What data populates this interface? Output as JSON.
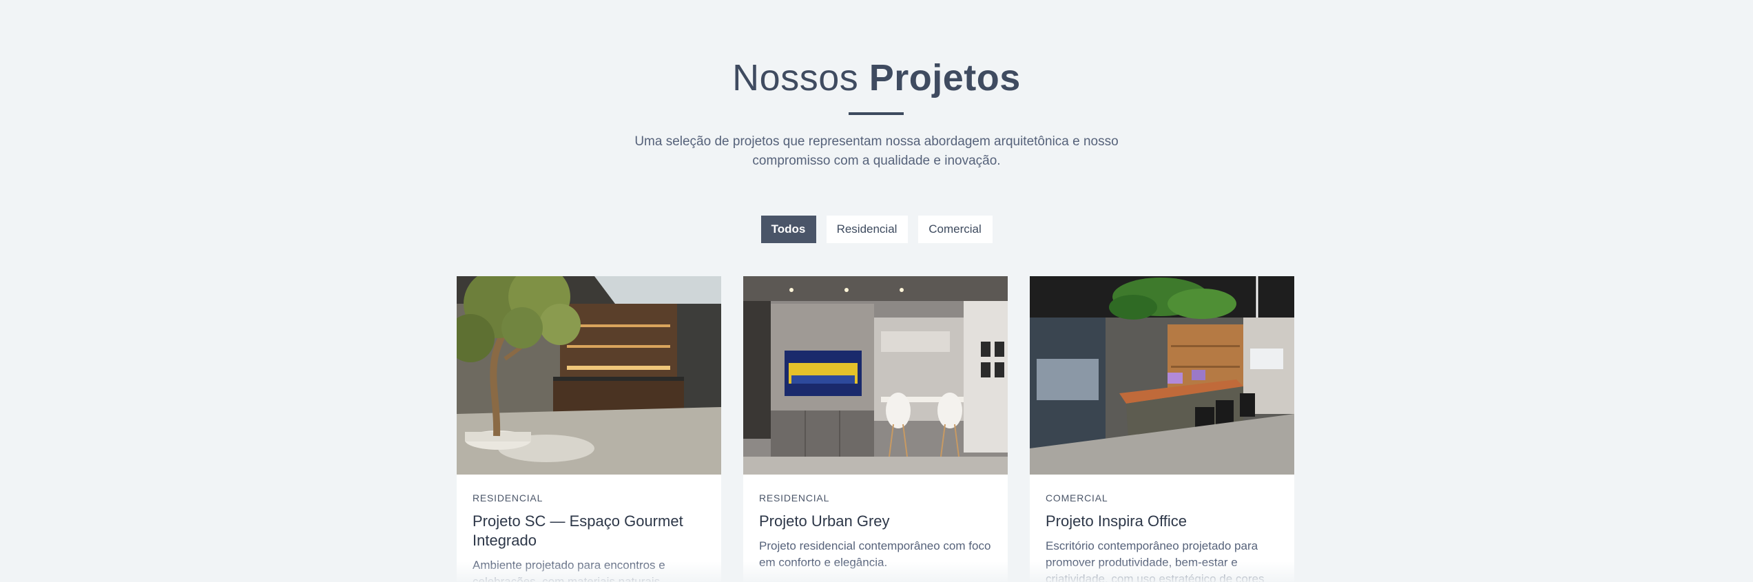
{
  "section": {
    "title_light": "Nossos",
    "title_bold": "Projetos",
    "intro": "Uma seleção de projetos que representam nossa abordagem arquitetônica e nosso compromisso com a qualidade e inovação."
  },
  "filters": [
    {
      "label": "Todos",
      "active": true
    },
    {
      "label": "Residencial",
      "active": false
    },
    {
      "label": "Comercial",
      "active": false
    }
  ],
  "projects": [
    {
      "category": "RESIDENCIAL",
      "title": "Projeto SC — Espaço Gourmet Integrado",
      "description": "Ambiente projetado para encontros e celebrações, com materiais naturais"
    },
    {
      "category": "RESIDENCIAL",
      "title": "Projeto Urban Grey",
      "description": "Projeto residencial contemporâneo com foco em conforto e elegância."
    },
    {
      "category": "COMERCIAL",
      "title": "Projeto Inspira Office",
      "description": "Escritório contemporâneo projetado para promover produtividade, bem-estar e criatividade, com uso estratégico de cores"
    }
  ],
  "colors": {
    "background": "#f1f4f6",
    "accent": "#4a5568",
    "text_dark": "#2d3748"
  }
}
